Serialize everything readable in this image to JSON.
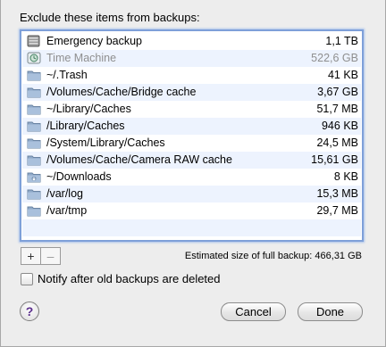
{
  "dialog": {
    "heading": "Exclude these items from backups:",
    "estimate_label": "Estimated size of full backup: 466,31 GB",
    "add_label": "+",
    "remove_label": "–",
    "checkbox_label": "Notify after old backups are deleted",
    "checkbox_checked": false,
    "help_label": "?",
    "cancel_label": "Cancel",
    "done_label": "Done"
  },
  "items": [
    {
      "name": "Emergency backup",
      "size": "1,1 TB",
      "icon": "drive-icon"
    },
    {
      "name": "Time Machine",
      "size": "522,6 GB",
      "icon": "time-machine-icon"
    },
    {
      "name": "~/.Trash",
      "size": "41 KB",
      "icon": "folder-icon"
    },
    {
      "name": "/Volumes/Cache/Bridge cache",
      "size": "3,67 GB",
      "icon": "folder-icon"
    },
    {
      "name": "~/Library/Caches",
      "size": "51,7 MB",
      "icon": "folder-icon"
    },
    {
      "name": "/Library/Caches",
      "size": "946 KB",
      "icon": "folder-icon"
    },
    {
      "name": "/System/Library/Caches",
      "size": "24,5 MB",
      "icon": "folder-icon"
    },
    {
      "name": "/Volumes/Cache/Camera RAW cache",
      "size": "15,61 GB",
      "icon": "folder-icon"
    },
    {
      "name": "~/Downloads",
      "size": "8 KB",
      "icon": "downloads-folder-icon"
    },
    {
      "name": "/var/log",
      "size": "15,3 MB",
      "icon": "folder-icon"
    },
    {
      "name": "/var/tmp",
      "size": "29,7 MB",
      "icon": "folder-icon"
    }
  ],
  "colors": {
    "list_border": "#7ea0d9",
    "alt_row": "#edf3fe",
    "dim_text": "#8f8f8f"
  }
}
